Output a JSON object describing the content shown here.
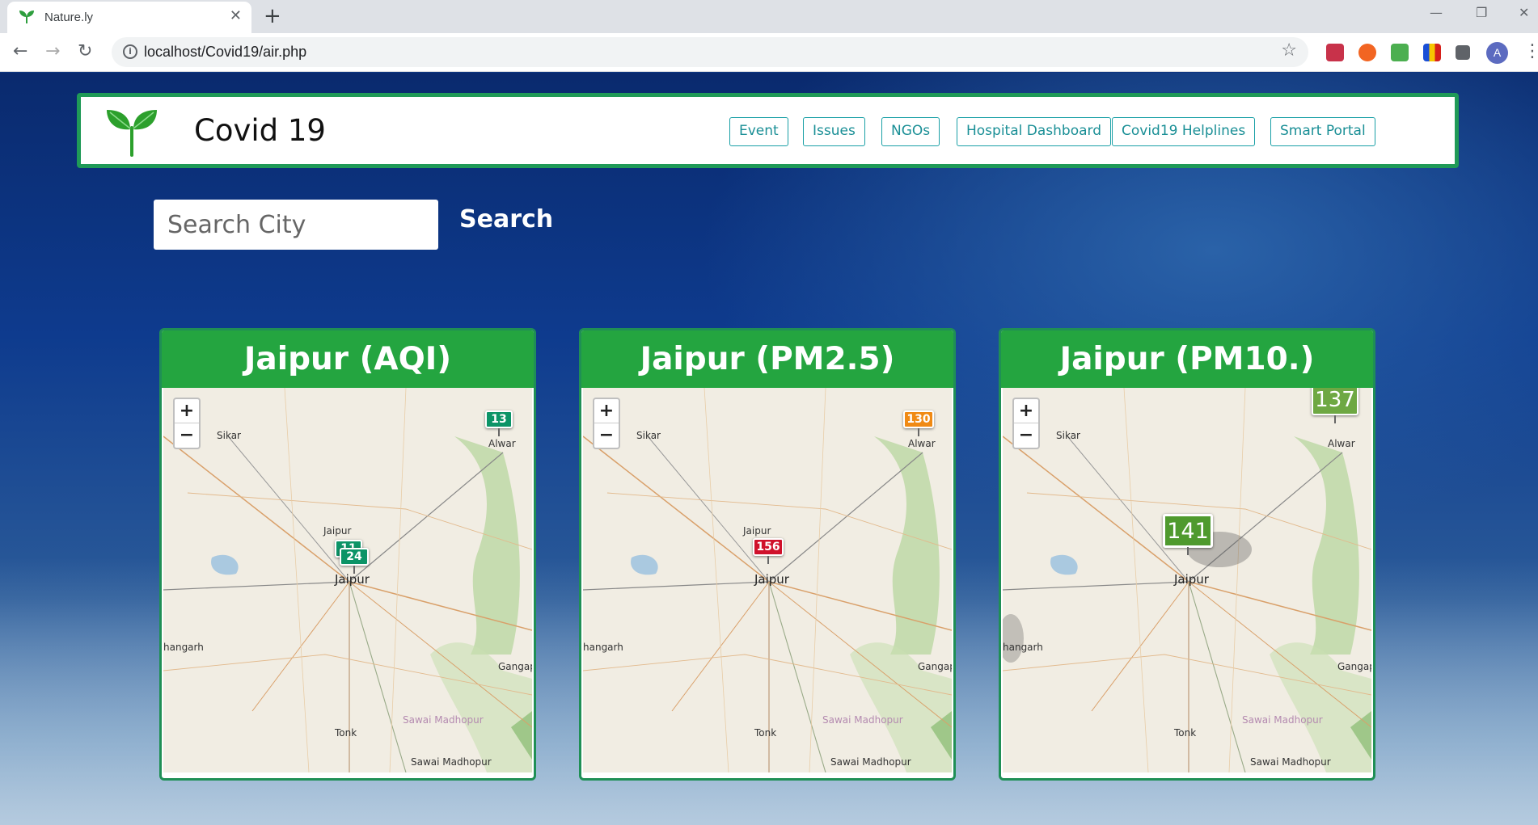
{
  "browser": {
    "tab_title": "Nature.ly",
    "url": "localhost/Covid19/air.php",
    "avatar_letter": "A"
  },
  "navbar": {
    "brand": "Covid 19",
    "links": [
      "Event",
      "Issues",
      "NGOs",
      "Hospital Dashboard",
      "Covid19 Helplines",
      "Smart Portal"
    ]
  },
  "search": {
    "placeholder": "Search City",
    "button_label": "Search"
  },
  "cards": [
    {
      "title": "Jaipur (AQI)",
      "markers": [
        {
          "value": "13",
          "color": "#0c9467"
        },
        {
          "value": "11",
          "color": "#0c9467"
        },
        {
          "value": "24",
          "color": "#0c9467"
        }
      ]
    },
    {
      "title": "Jaipur (PM2.5)",
      "markers": [
        {
          "value": "130",
          "color": "#f08a14"
        },
        {
          "value": "156",
          "color": "#d0112b"
        }
      ]
    },
    {
      "title": "Jaipur (PM10.)",
      "markers": [
        {
          "value": "137",
          "color": "#6ea843"
        },
        {
          "value": "141",
          "color": "#4f9a2e"
        }
      ]
    }
  ],
  "map_labels": {
    "sikar": "Sikar",
    "alwar": "Alwar",
    "jaipur": "Jaipur",
    "jaipur_small": "Jaipur",
    "hangarh": "hangarh",
    "gangap": "Gangap",
    "sawai_madhopur": "Sawai Madhopur",
    "tonk": "Tonk"
  },
  "zoom": {
    "in": "+",
    "out": "−"
  },
  "icons": {
    "back": "arrow-left-icon",
    "forward": "arrow-right-icon",
    "reload": "reload-icon",
    "star": "star-icon",
    "logo": "leaf-sprout-icon"
  }
}
